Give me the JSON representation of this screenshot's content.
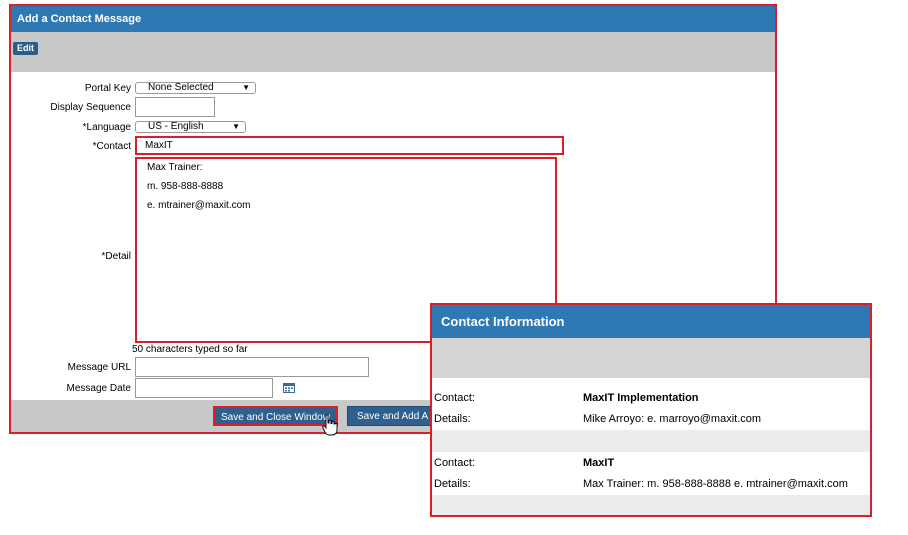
{
  "form": {
    "title": "Add a Contact Message",
    "edit_label": "Edit",
    "labels": {
      "portal_key": "Portal Key",
      "display_sequence": "Display Sequence",
      "language": "*Language",
      "contact": "*Contact",
      "detail": "*Detail",
      "message_url": "Message URL",
      "message_date": "Message Date"
    },
    "portal_key_value": "None Selected",
    "display_sequence_value": "",
    "language_value": "US - English",
    "contact_value": "MaxIT",
    "detail_lines": [
      "Max Trainer:",
      "m. 958-888-8888",
      "e. mtrainer@maxit.com"
    ],
    "char_count_text": "50 characters typed so far",
    "message_url_value": "",
    "message_date_value": "",
    "buttons": {
      "save_close": "Save and Close Window",
      "save_add": "Save and Add A"
    }
  },
  "contact_info": {
    "title": "Contact Information",
    "entries": [
      {
        "contact_key": "Contact:",
        "contact_value": "MaxIT Implementation",
        "details_key": "Details:",
        "details_value": "Mike Arroyo:  e. marroyo@maxit.com"
      },
      {
        "contact_key": "Contact:",
        "contact_value": "MaxIT",
        "details_key": "Details:",
        "details_value": "Max Trainer: m. 958-888-8888 e. mtrainer@maxit.com"
      }
    ]
  },
  "colors": {
    "header_blue": "#2e78b4",
    "highlight_red": "#d9202a",
    "toolbar_gray": "#c8c8c8",
    "button_blue": "#2e5f8e"
  },
  "icons": [
    "dropdown-arrow-icon",
    "calendar-icon",
    "hand-cursor-icon"
  ]
}
